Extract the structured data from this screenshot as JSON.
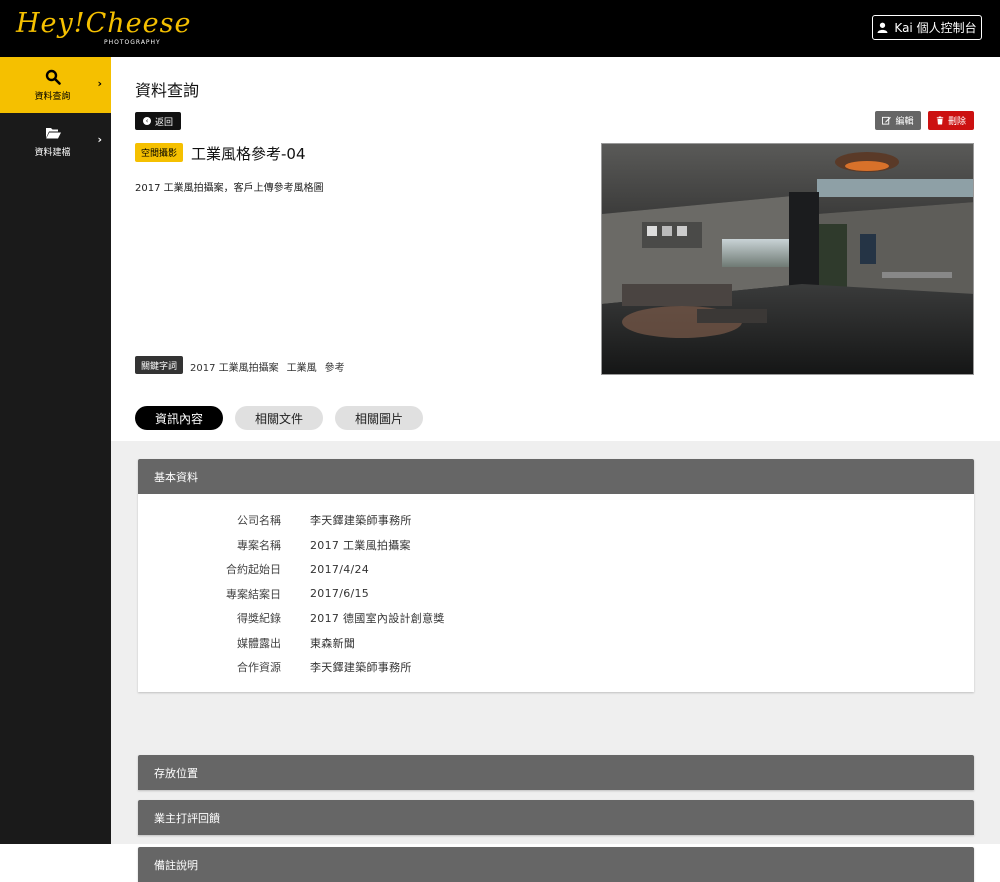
{
  "brand": {
    "name": "Hey!Cheese",
    "sub": "PHOTOGRAPHY"
  },
  "header": {
    "user_button": "Kai 個人控制台"
  },
  "sidebar": {
    "items": [
      {
        "label": "資料查詢",
        "icon": "search-icon",
        "active": true
      },
      {
        "label": "資料建檔",
        "icon": "folder-open-icon",
        "active": false
      }
    ]
  },
  "page": {
    "title": "資料查詢",
    "back_label": "返回",
    "edit_label": "編輯",
    "delete_label": "刪除",
    "category": "空間攝影",
    "item_title": "工業風格參考-04",
    "description": "2017 工業風拍攝案，客戶上傳參考風格圖",
    "keywords_label": "關鍵字詞",
    "keywords": [
      "2017 工業風拍攝案",
      "工業風",
      "參考"
    ]
  },
  "tabs": [
    {
      "label": "資訊內容",
      "active": true
    },
    {
      "label": "相關文件",
      "active": false
    },
    {
      "label": "相關圖片",
      "active": false
    }
  ],
  "panels": {
    "basic": {
      "title": "基本資料",
      "rows": [
        {
          "key": "公司名稱",
          "value": "李天鐸建築師事務所"
        },
        {
          "key": "專案名稱",
          "value": "2017 工業風拍攝案"
        },
        {
          "key": "合約起始日",
          "value": "2017/4/24"
        },
        {
          "key": "專案結案日",
          "value": "2017/6/15"
        },
        {
          "key": "得獎紀錄",
          "value": "2017 德國室內設計創意獎"
        },
        {
          "key": "媒體露出",
          "value": "東森新聞"
        },
        {
          "key": "合作資源",
          "value": "李天鐸建築師事務所"
        }
      ]
    },
    "storage": {
      "title": "存放位置"
    },
    "feedback": {
      "title": "業主打評回饋"
    },
    "notes": {
      "title": "備註說明"
    }
  },
  "colors": {
    "accent": "#f5c000",
    "danger": "#cc1111",
    "panel_header": "#666666",
    "sidebar_bg": "#1a1a1a"
  }
}
